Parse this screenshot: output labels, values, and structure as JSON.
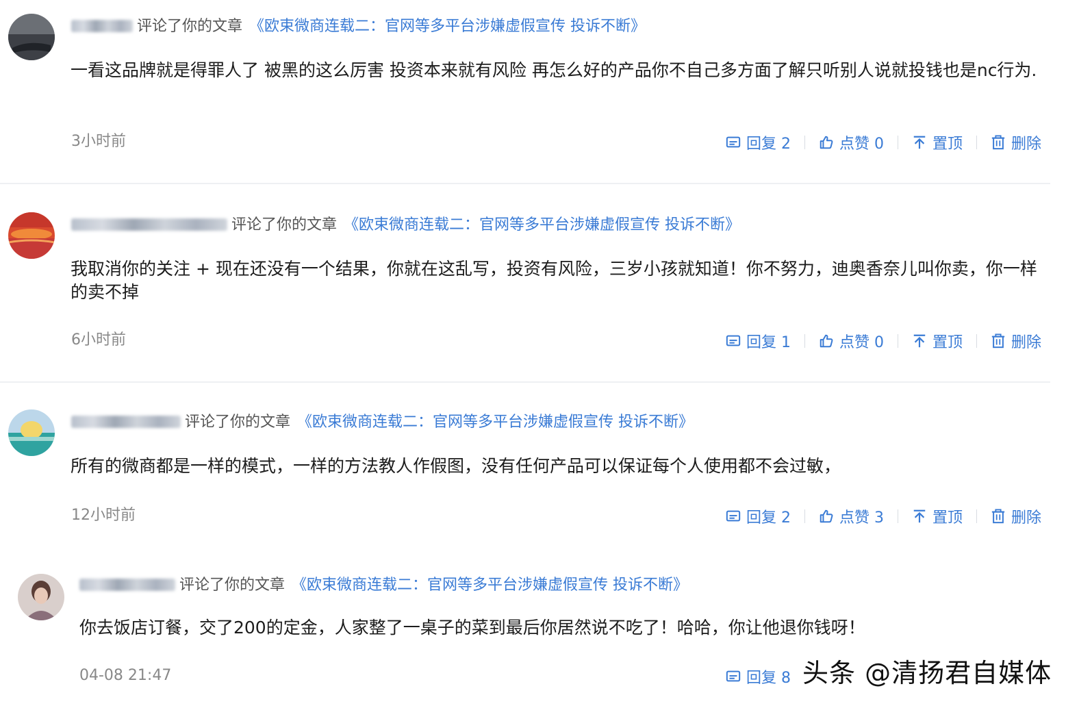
{
  "comments": [
    {
      "verb": "评论了你的文章",
      "article": "《欧束微商连载二：官网等多平台涉嫌虚假宣传 投诉不断》",
      "text": "一看这品牌就是得罪人了 被黑的这么厉害 投资本来就有风险 再怎么好的产品你不自己多方面了解只听别人说就投钱也是nc行为.",
      "time": "3小时前",
      "reply": "回复 2",
      "like": "点赞 0",
      "pin": "置顶",
      "delete": "删除"
    },
    {
      "verb": "评论了你的文章",
      "article": "《欧束微商连载二：官网等多平台涉嫌虚假宣传 投诉不断》",
      "text": "我取消你的关注 + 现在还没有一个结果，你就在这乱写，投资有风险，三岁小孩就知道！你不努力，迪奥香奈儿叫你卖，你一样的卖不掉",
      "time": "6小时前",
      "reply": "回复 1",
      "like": "点赞 0",
      "pin": "置顶",
      "delete": "删除"
    },
    {
      "verb": "评论了你的文章",
      "article": "《欧束微商连载二：官网等多平台涉嫌虚假宣传 投诉不断》",
      "text": "所有的微商都是一样的模式，一样的方法教人作假图，没有任何产品可以保证每个人使用都不会过敏，",
      "time": "12小时前",
      "reply": "回复 2",
      "like": "点赞 3",
      "pin": "置顶",
      "delete": "删除"
    },
    {
      "verb": "评论了你的文章",
      "article": "《欧束微商连载二：官网等多平台涉嫌虚假宣传 投诉不断》",
      "text": "你去饭店订餐，交了200的定金，人家整了一桌子的菜到最后你居然说不吃了！哈哈，你让他退你钱呀！",
      "time": "04-08 21:47",
      "reply": "回复 8"
    }
  ],
  "watermark": "头条 @清扬君自媒体",
  "colors": {
    "link": "#3a7bd5",
    "divider": "#eef0f3",
    "muted": "#888888"
  },
  "icons": {
    "reply": "comment-box-icon",
    "like": "thumbs-up-icon",
    "pin": "pin-top-icon",
    "delete": "trash-icon"
  }
}
